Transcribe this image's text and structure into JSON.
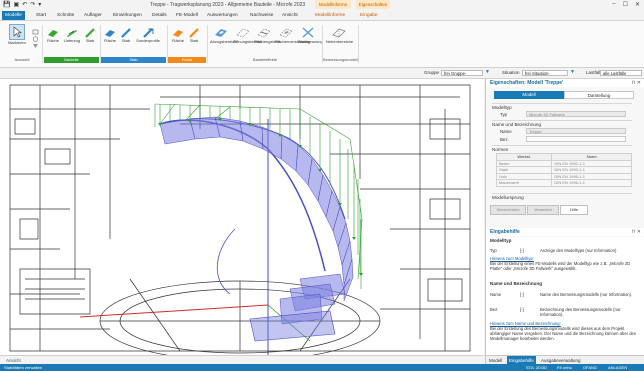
{
  "titlebar": {
    "quick_icons": [
      "save-icon",
      "new-icon",
      "undo-icon",
      "redo-icon",
      "dropdown-icon"
    ],
    "title": "Treppe - Tragwerksplanung 2023 - Allgemeine Bauteile - Microfe 2023",
    "context1": "Modellinformo",
    "context2": "Eigenschaften",
    "win_min": "–",
    "win_max": "☐",
    "win_close": "✕"
  },
  "tabs": [
    "Modelle",
    "Start",
    "Schnitte",
    "Auflager",
    "Einwirkungen",
    "Details",
    "FE-Modell",
    "Auswertungen",
    "Nachweise",
    "Ansicht",
    "Modellinforme",
    "Eingabe"
  ],
  "ribbon": {
    "groups": [
      {
        "name": "Auswahl",
        "buttons": [
          "Markieren"
        ]
      },
      {
        "name": "Bauteile",
        "buttons": [
          "Fläche",
          "Unterzug",
          "Stab"
        ]
      },
      {
        "name": "Stab",
        "buttons": [
          "Fläche",
          "Stab",
          "Sonderprofile"
        ]
      },
      {
        "name": "Punkt",
        "buttons": [
          "Fläche",
          "Stab"
        ]
      },
      {
        "name": "Bauteileffekte",
        "buttons": [
          "Abzugsbereich",
          "Öffnungsbereich",
          "Flächengelenk",
          "Flächenverstärkung",
          "Stabkreuzung"
        ]
      },
      {
        "name": "Bemessungsmodell",
        "buttons": [
          "Nebenbereiche"
        ]
      }
    ]
  },
  "toolbar2": {
    "gruppe_label": "Gruppe",
    "gruppe_value": "frei Gruppe-",
    "situation_label": "Situation",
    "situation_value": "frei Situation-",
    "lastfall_label": "Lastfall",
    "lastfall_value": "alle Lastfälle"
  },
  "panel": {
    "title": "Eigenschaften: Modell 'Treppe'",
    "tab_model": "Modell",
    "tab_display": "Darstellung",
    "section_modeltyp": "Modelltyp",
    "typ_label": "Typ",
    "typ_value": "Microfe 3D Faltwerk",
    "section_name": "Name und Bezeichnung",
    "name_label": "Name",
    "name_value": "Treppe",
    "bez_label": "Bez.",
    "bez_value": "",
    "section_normen": "Normen",
    "normen_header_werkstoff": "Werkst.",
    "normen_header_norm": "Norm",
    "normen_rows": [
      {
        "werkstoff": "Beton",
        "norm": "DIN EN 1992-1-1"
      },
      {
        "werkstoff": "Stahl",
        "norm": "DIN EN 1993-1-1"
      },
      {
        "werkstoff": "Holz",
        "norm": "DIN EN 1995-1-1"
      },
      {
        "werkstoff": "Mauerwerk",
        "norm": "DIN EN 1996-1-1"
      }
    ],
    "section_ursprung": "Modellursprung",
    "btn_uebernehmen": "Übernehmen",
    "btn_verwerfen": "Verwerfen",
    "btn_hilfe": "Hilfe",
    "help_title": "Eingabehilfe",
    "help_h1": "Modelltyp",
    "help_typ_label": "Typ",
    "help_typ_unit": "[-]",
    "help_typ_text": "Anzeige des Modelltyps (nur Information)",
    "help_hinweis1": "Hinweis zum Modelltyp:",
    "help_hinweis1_text": "Bei der Erstellung eines FE-Modells wird der Modelltyp wie z.B. „Microfe 2D Platte\" oder „Microfe 3D Faltwerk\" ausgewählt.",
    "help_h2": "Name und Bezeichnung",
    "help_name_label": "Name",
    "help_name_unit": "[-]",
    "help_name_text": "Name des Bemessungsmodells (nur Information).",
    "help_bez_label": "Bez.",
    "help_bez_unit": "[-]",
    "help_bez_text": "Bezeichnung des Bemessungsmodells (nur Information).",
    "help_hinweis2": "Hinweis zum Name und Bezeichnung:",
    "help_hinweis2_text": "Bei der Erstellung des Bemessungsmodells wird dieses aus dem Projekt abhängiger Name vergeben. Der Name und die Bezeichnung können über den Modellmanager bearbeitet werden.",
    "bottom_tabs": [
      "Modell",
      "Eingabehilfe",
      "Ausgabeverwaltung"
    ]
  },
  "viewport": {
    "bottom_tab": "Ansicht"
  },
  "status": {
    "left": "Stabilitäten verwalten",
    "right_items": [
      "STA: 2D/3D",
      "F8 ortho",
      "OFANG",
      "ANLAGEN"
    ]
  },
  "colors": {
    "accent": "#1a7ab5",
    "context": "#fde7c4",
    "load_green": "#2e9e2e",
    "stair_blue": "#6f72d8"
  }
}
